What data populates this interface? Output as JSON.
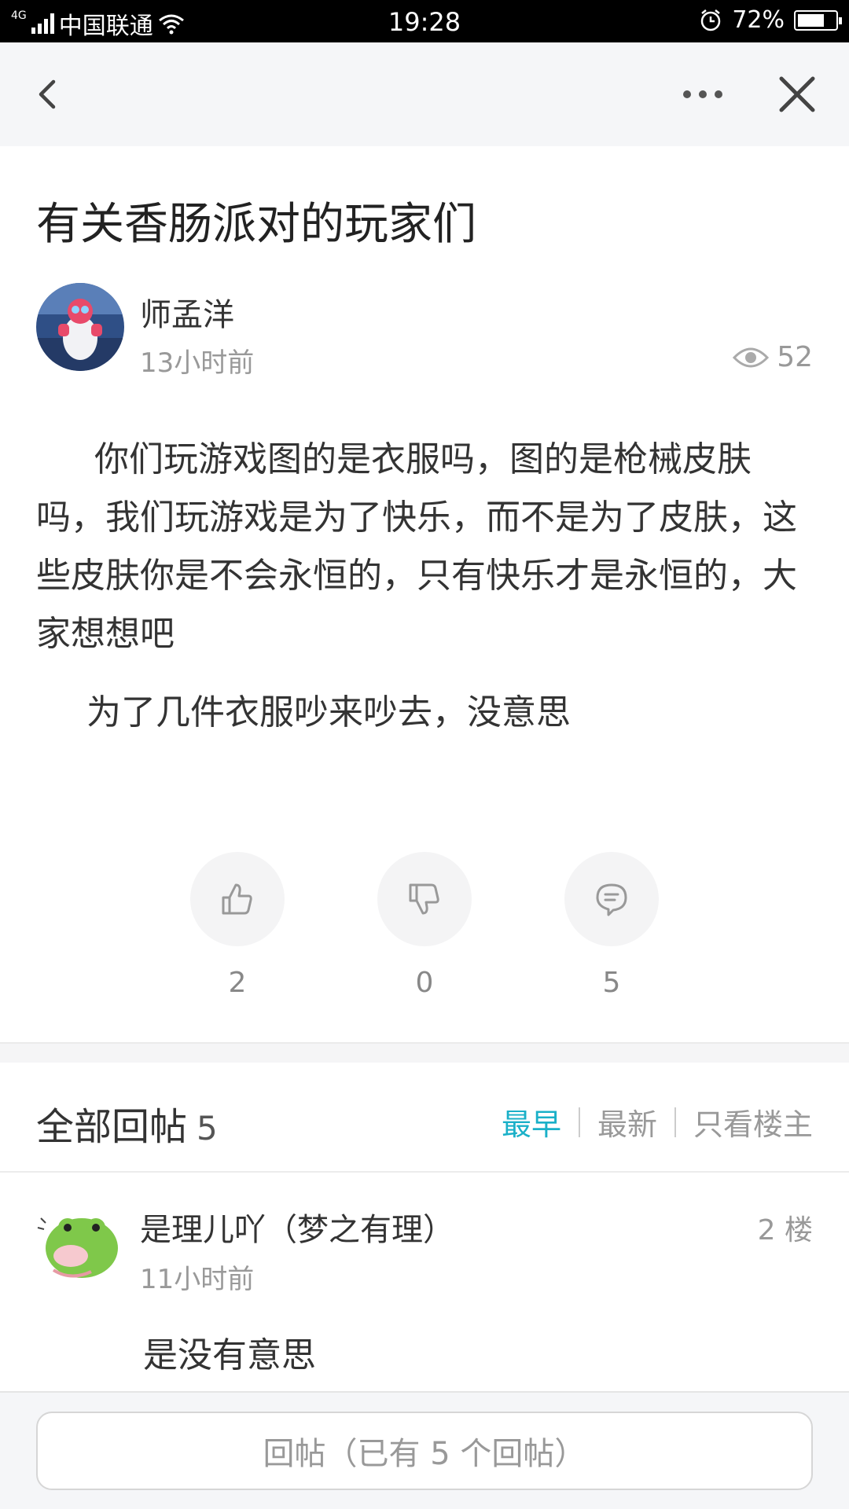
{
  "status_bar": {
    "network": "4G",
    "carrier": "中国联通",
    "time": "19:28",
    "battery": "72%",
    "battery_level": 0.72
  },
  "nav": {
    "back_icon": "chevron-left-icon",
    "more_icon": "more-dots-icon",
    "close_icon": "close-icon"
  },
  "post": {
    "title": "有关香肠派对的玩家们",
    "author": "师孟洋",
    "time": "13小时前",
    "views": "52",
    "paragraphs": [
      "你们玩游戏图的是衣服吗，图的是枪械皮肤吗，我们玩游戏是为了快乐，而不是为了皮肤，这些皮肤你是不会永恒的，只有快乐才是永恒的，大家想想吧",
      "为了几件衣服吵来吵去，没意思"
    ],
    "actions": {
      "likes": "2",
      "dislikes": "0",
      "comments": "5"
    }
  },
  "replies": {
    "title": "全部回帖",
    "count": "5",
    "sort": {
      "earliest": "最早",
      "latest": "最新",
      "owner_only": "只看楼主"
    },
    "items": [
      {
        "name": "是理儿吖（梦之有理）",
        "floor": "2 楼",
        "time": "11小时前",
        "text": "是没有意思"
      }
    ]
  },
  "bottom": {
    "reply_placeholder": "回帖（已有 5 个回帖）"
  },
  "colors": {
    "accent": "#1ab0c8",
    "muted": "#999999"
  }
}
